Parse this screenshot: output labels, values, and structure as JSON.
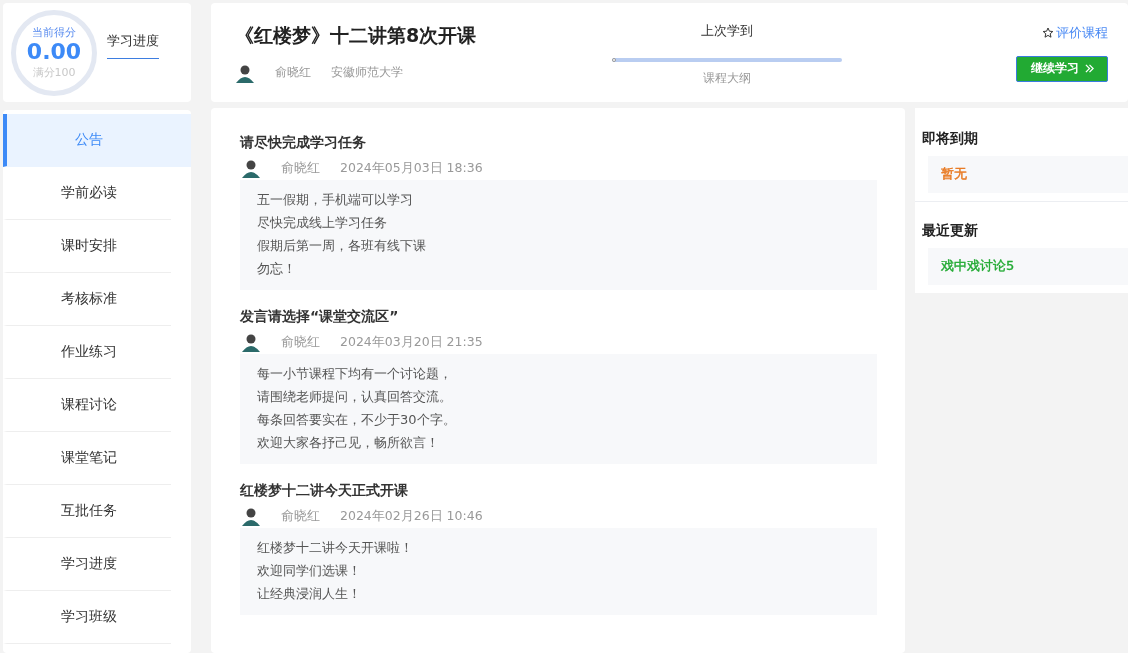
{
  "score": {
    "label": "当前得分",
    "value": "0.00",
    "max": "满分100"
  },
  "progress_link": "学习进度",
  "course": {
    "title": "《红楼梦》十二讲第8次开课",
    "teacher": "俞晓红",
    "school": "安徽师范大学"
  },
  "last_study": {
    "label": "上次学到",
    "level": 0,
    "outline": "课程大纲"
  },
  "rate_link": "评价课程",
  "continue_button": "继续学习",
  "sidebar": [
    {
      "label": "公告",
      "selected": true
    },
    {
      "label": "学前必读",
      "selected": false
    },
    {
      "label": "课时安排",
      "selected": false
    },
    {
      "label": "考核标准",
      "selected": false
    },
    {
      "label": "作业练习",
      "selected": false
    },
    {
      "label": "课程讨论",
      "selected": false
    },
    {
      "label": "课堂笔记",
      "selected": false
    },
    {
      "label": "互批任务",
      "selected": false
    },
    {
      "label": "学习进度",
      "selected": false
    },
    {
      "label": "学习班级",
      "selected": false
    }
  ],
  "announcements": [
    {
      "title": "请尽快完成学习任务",
      "author": "俞晓红",
      "time": "2024年05月03日 18:36",
      "lines": [
        "五一假期，手机端可以学习",
        "尽快完成线上学习任务",
        "假期后第一周，各班有线下课",
        "勿忘！"
      ]
    },
    {
      "title": "发言请选择“课堂交流区”",
      "author": "俞晓红",
      "time": "2024年03月20日 21:35",
      "lines": [
        "每一小节课程下均有一个讨论题，",
        "请围绕老师提问，认真回答交流。",
        "每条回答要实在，不少于30个字。",
        "欢迎大家各抒己见，畅所欲言！"
      ]
    },
    {
      "title": "红楼梦十二讲今天正式开课",
      "author": "俞晓红",
      "time": "2024年02月26日 10:46",
      "lines": [
        "红楼梦十二讲今天开课啦！",
        "欢迎同学们选课！",
        "让经典浸润人生！"
      ]
    }
  ],
  "side_sections": [
    {
      "title": "即将到期",
      "item": "暂无",
      "color": "#e8751a"
    },
    {
      "title": "最近更新",
      "item": "戏中戏讨论5",
      "color": "#22aa33"
    }
  ]
}
